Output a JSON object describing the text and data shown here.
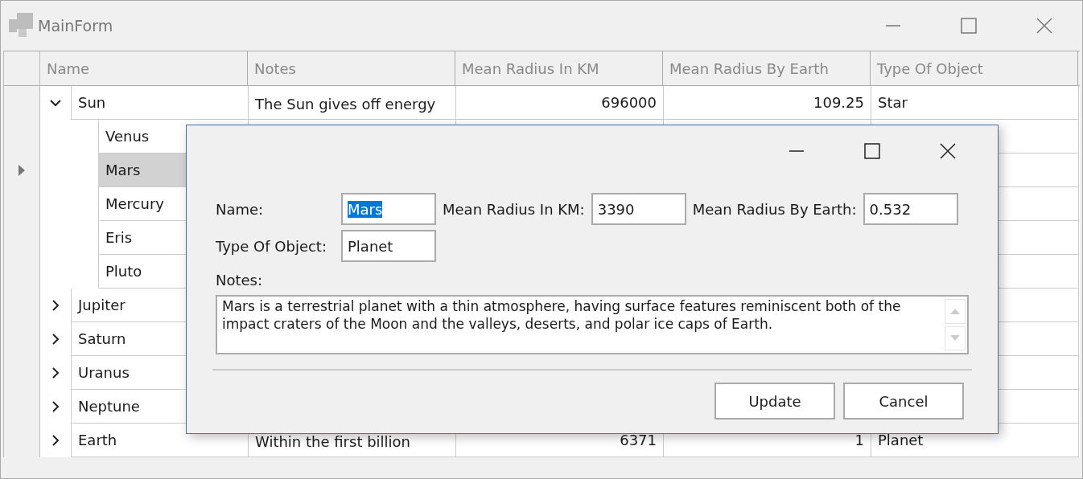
{
  "window": {
    "title": "MainForm"
  },
  "grid": {
    "columns": [
      "Name",
      "Notes",
      "Mean Radius In KM",
      "Mean Radius By Earth",
      "Type Of Object"
    ],
    "rows": [
      {
        "name": "Sun",
        "notes": "The Sun gives off energy",
        "km": "696000",
        "earth": "109.25",
        "type": "Star",
        "expanded": true,
        "selected": false,
        "children": [
          {
            "name": "Venus",
            "selected": false
          },
          {
            "name": "Mars",
            "selected": true
          },
          {
            "name": "Mercury",
            "selected": false
          },
          {
            "name": "Eris",
            "selected": false
          },
          {
            "name": "Pluto",
            "selected": false
          }
        ]
      },
      {
        "name": "Jupiter",
        "expanded": false,
        "selected": false
      },
      {
        "name": "Saturn",
        "expanded": false,
        "selected": false
      },
      {
        "name": "Uranus",
        "expanded": false,
        "selected": false
      },
      {
        "name": "Neptune",
        "expanded": false,
        "selected": false
      },
      {
        "name": "Earth",
        "notes": "Within the first billion",
        "km": "6371",
        "earth": "1",
        "type": "Planet",
        "expanded": false,
        "selected": false
      }
    ]
  },
  "dialog": {
    "fields": [
      {
        "label": "Name:",
        "value": "Mars",
        "text_selected": true
      },
      {
        "label": "Mean Radius In KM:",
        "value": "3390",
        "text_selected": false
      },
      {
        "label": "Mean Radius By Earth:",
        "value": "0.532",
        "text_selected": false
      },
      {
        "label": "Type Of Object:",
        "value": "Planet",
        "text_selected": false
      }
    ],
    "notes_label": "Notes:",
    "notes": "Mars is a terrestrial planet with a thin atmosphere, having surface features reminiscent both of the impact craters of the Moon and the valleys, deserts, and polar ice caps of Earth.",
    "buttons": [
      "Update",
      "Cancel"
    ]
  }
}
